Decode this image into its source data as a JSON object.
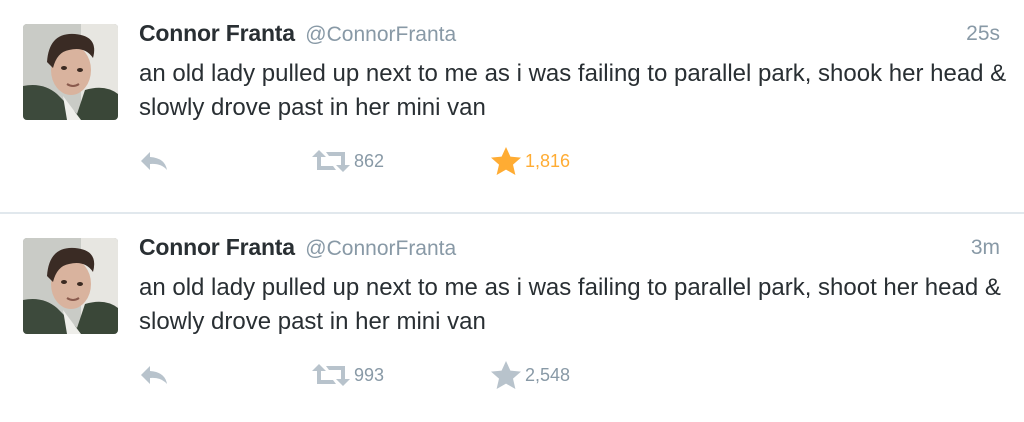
{
  "colors": {
    "text": "#292f33",
    "muted": "#8899a6",
    "icon": "#b8c3cc",
    "favorite_active": "#ffac33",
    "divider": "#e1e8ed"
  },
  "tweets": [
    {
      "name": "Connor Franta",
      "handle": "@ConnorFranta",
      "time": "25s",
      "text": "an old lady pulled up next to me as i was failing to parallel park, shook her head & slowly drove past in her mini van",
      "retweets": "862",
      "favorites": "1,816",
      "favorited": true,
      "icons": {
        "reply": "reply-icon",
        "retweet": "retweet-icon",
        "favorite": "star-icon"
      }
    },
    {
      "name": "Connor Franta",
      "handle": "@ConnorFranta",
      "time": "3m",
      "text": "an old lady pulled up next to me as i was failing to parallel park, shoot her head & slowly drove past in her mini van",
      "retweets": "993",
      "favorites": "2,548",
      "favorited": false,
      "icons": {
        "reply": "reply-icon",
        "retweet": "retweet-icon",
        "favorite": "star-icon"
      }
    }
  ]
}
